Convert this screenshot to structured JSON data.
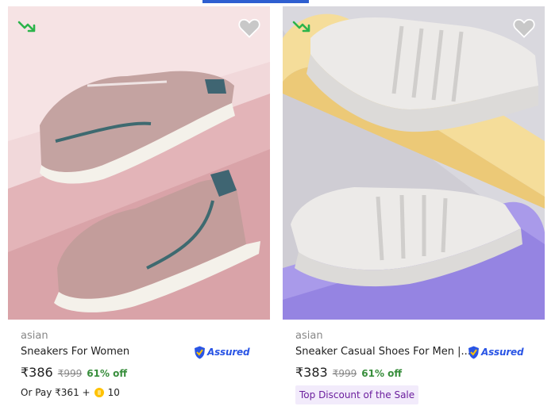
{
  "products": [
    {
      "brand": "asian",
      "title": "Sneakers For Women",
      "assured_label": "Assured",
      "price": "₹386",
      "mrp": "₹999",
      "discount": "61% off",
      "pay_label": "Or Pay ₹361 +",
      "coins": "10",
      "icons": [
        "trend-down-icon",
        "heart-icon",
        "assured-shield-icon",
        "coin-icon"
      ]
    },
    {
      "brand": "asian",
      "title": "Sneaker Casual Shoes For Men |...",
      "assured_label": "Assured",
      "price": "₹383",
      "mrp": "₹999",
      "discount": "61% off",
      "tag": "Top Discount of the Sale",
      "icons": [
        "trend-down-icon",
        "heart-icon",
        "assured-shield-icon"
      ]
    }
  ],
  "colors": {
    "accent_blue": "#2a55e5",
    "discount_green": "#388e3c",
    "tag_bg": "#f2ebfb",
    "tag_text": "#6c1f9e"
  }
}
